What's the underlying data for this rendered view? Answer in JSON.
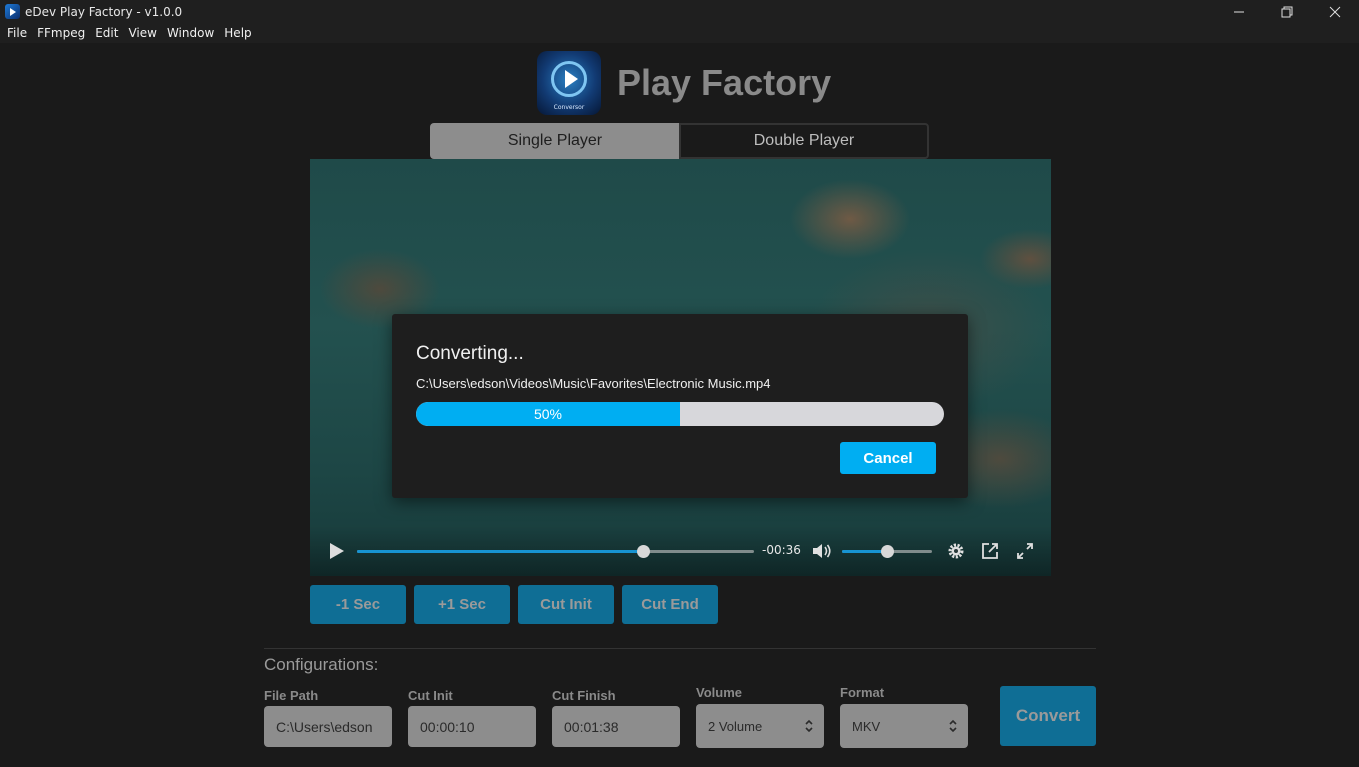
{
  "window": {
    "title": "eDev Play Factory - v1.0.0",
    "minimize_icon": "minimize-icon",
    "maximize_icon": "restore-icon",
    "close_icon": "close-icon"
  },
  "menu": [
    "File",
    "FFmpeg",
    "Edit",
    "View",
    "Window",
    "Help"
  ],
  "header": {
    "logo_caption": "Conversor",
    "title": "Play Factory"
  },
  "tabs": [
    {
      "label": "Single Player",
      "active": true
    },
    {
      "label": "Double Player",
      "active": false
    }
  ],
  "player": {
    "seek_fraction": 0.72,
    "time_remaining": "-00:36",
    "volume_fraction": 0.5
  },
  "dialog": {
    "title": "Converting...",
    "file_path": "C:\\Users\\edson\\Videos\\Music\\Favorites\\Electronic Music.mp4",
    "progress_fraction": 0.5,
    "progress_label": "50%",
    "cancel_label": "Cancel"
  },
  "actions": [
    "-1 Sec",
    "+1 Sec",
    "Cut Init",
    "Cut End"
  ],
  "config": {
    "title": "Configurations:",
    "file_path": {
      "label": "File Path",
      "value": "C:\\Users\\edson"
    },
    "cut_init": {
      "label": "Cut Init",
      "value": "00:00:10"
    },
    "cut_finish": {
      "label": "Cut Finish",
      "value": "00:01:38"
    },
    "volume": {
      "label": "Volume",
      "value": "2 Volume"
    },
    "format": {
      "label": "Format",
      "value": "MKV"
    },
    "convert_label": "Convert"
  },
  "colors": {
    "accent": "#00aef2",
    "button_dark": "#0f6e95",
    "background": "#1a1a1a"
  }
}
